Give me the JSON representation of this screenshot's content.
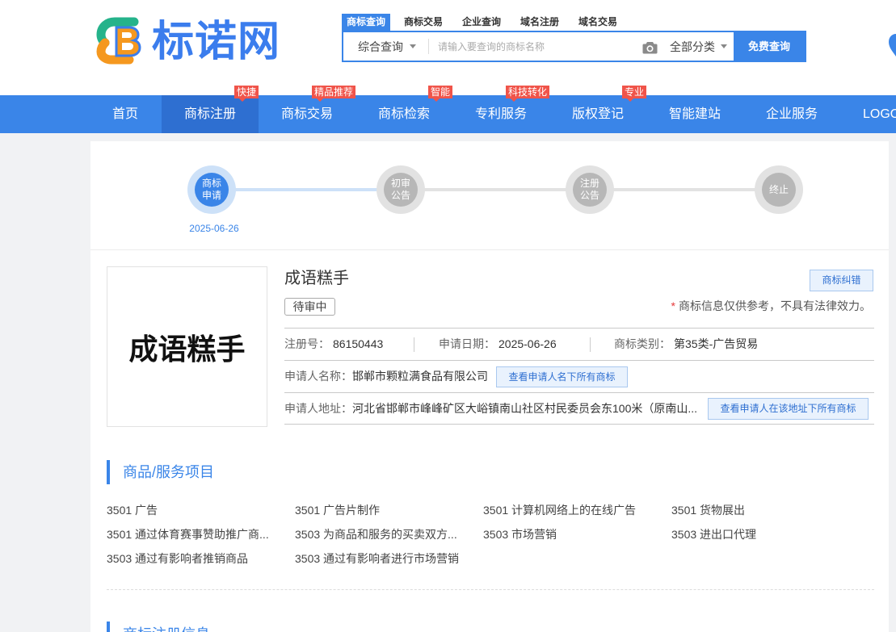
{
  "colors": {
    "accent": "#3a85e8",
    "accent_dark": "#2e6fd1",
    "badge": "#f0544a",
    "btn_bg": "#e9f2fd",
    "btn_border": "#a9c8ef",
    "page_bg": "#f1f2f4",
    "step_active_ring": "#cde1f8",
    "step_inactive": "#b7b7b7",
    "step_inactive_ring": "#e2e2e2",
    "logo_blue": "#3b7ded",
    "logo_green": "#25b38b",
    "logo_orange": "#f5981f",
    "danger": "#e5393a"
  },
  "logo": {
    "text": "标诺网",
    "icon": "logo-mark-icon"
  },
  "search": {
    "tabs": [
      {
        "label": "商标查询",
        "active": true
      },
      {
        "label": "商标交易",
        "active": false
      },
      {
        "label": "企业查询",
        "active": false
      },
      {
        "label": "域名注册",
        "active": false
      },
      {
        "label": "域名交易",
        "active": false
      }
    ],
    "scope_select": "综合查询",
    "placeholder": "请输入要查询的商标名称",
    "image_search_icon": "camera-icon",
    "category_select": "全部分类",
    "submit_label": "免费查询"
  },
  "nav": {
    "items": [
      {
        "label": "首页"
      },
      {
        "label": "商标注册",
        "badge": "快捷",
        "active": true
      },
      {
        "label": "商标交易",
        "badge": "精品推荐"
      },
      {
        "label": "商标检索",
        "badge": "智能"
      },
      {
        "label": "专利服务",
        "badge": "科技转化"
      },
      {
        "label": "版权登记",
        "badge": "专业"
      },
      {
        "label": "智能建站"
      },
      {
        "label": "企业服务"
      },
      {
        "label": "LOGO"
      }
    ]
  },
  "progress": {
    "steps": [
      {
        "lines": [
          "商标",
          "申请"
        ],
        "active": true,
        "date": "2025-06-26"
      },
      {
        "lines": [
          "初审",
          "公告"
        ],
        "active": false
      },
      {
        "lines": [
          "注册",
          "公告"
        ],
        "active": false
      },
      {
        "lines": [
          "终止"
        ],
        "active": false
      }
    ]
  },
  "trademark": {
    "image_text": "成语糕手",
    "name": "成语糕手",
    "status": "待审中",
    "correction_button": "商标纠错",
    "disclaimer_mark": "*",
    "disclaimer": "商标信息仅供参考，不具有法律效力。",
    "reg_no_label": "注册号：",
    "reg_no": "86150443",
    "apply_date_label": "申请日期：",
    "apply_date": "2025-06-26",
    "class_label": "商标类别：",
    "class": "第35类-广告贸易",
    "applicant_label": "申请人名称：",
    "applicant": "邯郸市颗粒满食品有限公司",
    "applicant_button": "查看申请人名下所有商标",
    "address_label": "申请人地址：",
    "address": "河北省邯郸市峰峰矿区大峪镇南山社区村民委员会东100米（原南山...",
    "address_button": "查看申请人在该地址下所有商标"
  },
  "goods_services": {
    "title": "商品/服务项目",
    "items": [
      "3501 广告",
      "3501 广告片制作",
      "3501 计算机网络上的在线广告",
      "3501 货物展出",
      "3501 通过体育赛事赞助推广商...",
      "3503 为商品和服务的买卖双方...",
      "3503 市场营销",
      "3503 进出口代理",
      "3503 通过有影响者推销商品",
      "3503 通过有影响者进行市场营销"
    ]
  },
  "next_section": {
    "title": "商标注册信息"
  }
}
